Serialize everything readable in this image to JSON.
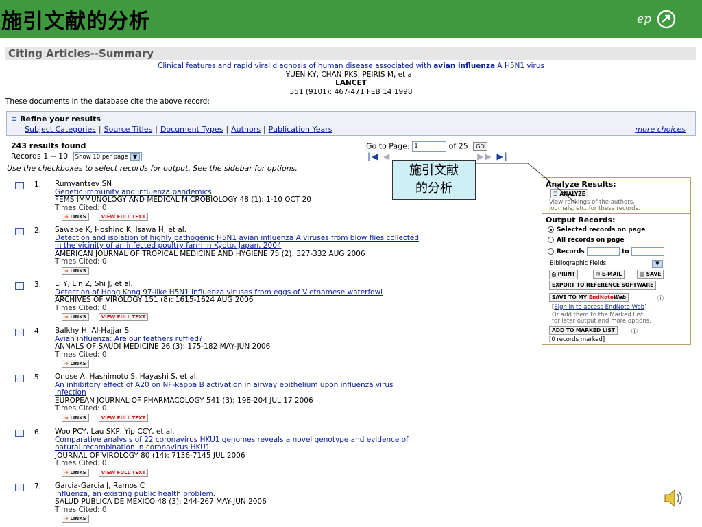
{
  "slide": {
    "title": "施引文献的分析",
    "brand": "ep"
  },
  "header": {
    "title": "Citing Articles--Summary"
  },
  "cited_ref": {
    "title_prefix": "Clinical features and rapid viral diagnosis of human disease associated with ",
    "title_bold": "avian influenza",
    "title_suffix": " A H5N1 virus",
    "authors": "YUEN KY, CHAN PKS, PEIRIS M, et al.",
    "journal": "LANCET",
    "citation": "351 (9101): 467-471 FEB 14 1998"
  },
  "intro_text": "These documents in the database cite the above record:",
  "refine": {
    "title": "Refine your results",
    "links": [
      "Subject Categories",
      "Source Titles",
      "Document Types",
      "Authors",
      "Publication Years"
    ],
    "more": "more choices"
  },
  "results": {
    "found": "243 results found",
    "records_label": "Records 1 -- 10",
    "per_page": "Show 10 per page",
    "goto_label": "Go to Page:",
    "goto_value": "1",
    "of_pages": "of 25",
    "go_button": "GO",
    "instructions": "Use the checkboxes to select records for output. See the sidebar for options."
  },
  "callout": {
    "line1": "施引文献",
    "line2": "的分析"
  },
  "records": [
    {
      "num": "1.",
      "authors": "Rumyantsev SN",
      "title": "Genetic immunity and influenza pandemics",
      "title2": "",
      "source": "FEMS IMMUNOLOGY AND MEDICAL MICROBIOLOGY 48 (1): 1-10 OCT 20",
      "cited": "Times Cited: 0",
      "links": "LINKS",
      "fulltext": "VIEW FULL TEXT"
    },
    {
      "num": "2.",
      "authors": "Sawabe K, Hoshino K, Isawa H, et al.",
      "title": "Detection and isolation of highly pathogenic H5N1 avian influenza A viruses from blow flies collected",
      "title2": "in the vicinity of an infected poultry farm in Kyoto, Japan, 2004",
      "source": "AMERICAN JOURNAL OF TROPICAL MEDICINE AND HYGIENE 75 (2): 327-332 AUG 2006",
      "cited": "Times Cited: 0",
      "links": "LINKS",
      "fulltext": ""
    },
    {
      "num": "3.",
      "authors": "Li Y, Lin Z, Shi J, et al.",
      "title": "Detection of Hong Kong 97-like H5N1 influenza viruses from eggs of Vietnamese waterfowl",
      "title2": "",
      "source": "ARCHIVES OF VIROLOGY 151 (8): 1615-1624 AUG 2006",
      "cited": "Times Cited: 0",
      "links": "LINKS",
      "fulltext": "VIEW FULL TEXT"
    },
    {
      "num": "4.",
      "authors": "Balkhy H, Al-Hajjar S",
      "title": "Avian influenza: Are our feathers ruffled?",
      "title2": "",
      "source": "ANNALS OF SAUDI MEDICINE 26 (3): 175-182 MAY-JUN 2006",
      "cited": "Times Cited: 0",
      "links": "LINKS",
      "fulltext": ""
    },
    {
      "num": "5.",
      "authors": "Onose A, Hashimoto S, Hayashi S, et al.",
      "title": "An inhibitory effect of A20 on NF-kappa B activation in airway epithelium upon influenza virus",
      "title2": "infection",
      "source": "EUROPEAN JOURNAL OF PHARMACOLOGY 541 (3): 198-204 JUL 17 2006",
      "cited": "Times Cited: 0",
      "links": "LINKS",
      "fulltext": "VIEW FULL TEXT"
    },
    {
      "num": "6.",
      "authors": "Woo PCY, Lau SKP, Yip CCY, et al.",
      "title": "Comparative analysis of 22 coronavirus HKU1 genomes reveals a novel genotype and evidence of",
      "title2": "natural recombination in coronavirus HKU1",
      "source": "JOURNAL OF VIROLOGY 80 (14): 7136-7145 JUL 2006",
      "cited": "Times Cited: 0",
      "links": "LINKS",
      "fulltext": "VIEW FULL TEXT"
    },
    {
      "num": "7.",
      "authors": "Garcia-Garcia J, Ramos C",
      "title": "Influenza, an existing public health problem.",
      "title2": "",
      "source": "SALUD PUBLICA DE MEXICO 48 (3): 244-267 MAY-JUN 2006",
      "cited": "Times Cited: 0",
      "links": "LINKS",
      "fulltext": ""
    }
  ],
  "sidebar": {
    "analyze_title": "Analyze Results:",
    "analyze_button": "ANALYZE",
    "analyze_desc1": "View rankings of the authors,",
    "analyze_desc2": "journals, etc. for these records.",
    "output_title": "Output Records:",
    "opt_selected": "Selected records on page",
    "opt_all": "All records on page",
    "opt_records": "Records",
    "opt_to": "to",
    "fields_select": "Bibliographic Fields",
    "print": "PRINT",
    "email": "E-MAIL",
    "save": "SAVE",
    "export": "EXPORT TO REFERENCE SOFTWARE",
    "endnote_prefix": "SAVE TO MY ",
    "endnote_brand": "EndNote",
    "endnote_web": "Web",
    "signin": "Sign in to access EndNote Web",
    "or_add1": "Or add them to the Marked List",
    "or_add2": "for later output and more options.",
    "marked_button": "ADD TO MARKED LIST",
    "marked_count": "[0 records marked]"
  },
  "colors": {
    "slide_bar": "#3f9a3f",
    "link": "#0a1ea0",
    "callout_bg": "#cfeff6",
    "endnote_red": "#d01818"
  }
}
